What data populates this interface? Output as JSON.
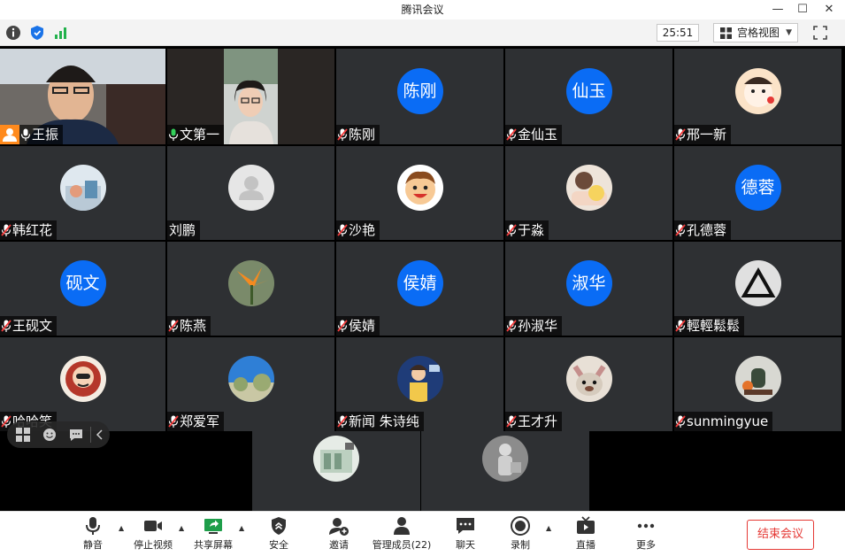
{
  "window": {
    "title": "腾讯会议",
    "minimize": "—",
    "maximize": "☐",
    "close": "✕"
  },
  "topbar": {
    "timer": "25:51",
    "view_mode": "宫格视图"
  },
  "colors": {
    "accent": "#0a6cf5",
    "active_speaker": "#20c05a",
    "host_badge": "#ff8a1d",
    "end_meeting": "#e53935"
  },
  "participants": [
    {
      "name": "王振",
      "avatar": "video",
      "mic": "on",
      "host": true
    },
    {
      "name": "文第一",
      "avatar": "video",
      "mic": "on",
      "active": true
    },
    {
      "name": "陈刚",
      "avatar": "text",
      "avatar_text": "陈刚",
      "mic": "muted"
    },
    {
      "name": "金仙玉",
      "avatar": "text",
      "avatar_text": "仙玉",
      "mic": "muted"
    },
    {
      "name": "邢一新",
      "avatar": "image-cartoon-girl",
      "mic": "muted"
    },
    {
      "name": "韩红花",
      "avatar": "image-photo",
      "mic": "muted"
    },
    {
      "name": "刘鹏",
      "avatar": "default-user",
      "mic": "none"
    },
    {
      "name": "沙艳",
      "avatar": "image-cartoon-boy",
      "mic": "muted"
    },
    {
      "name": "于淼",
      "avatar": "image-sleeping-child",
      "mic": "muted"
    },
    {
      "name": "孔德蓉",
      "avatar": "text",
      "avatar_text": "德蓉",
      "mic": "muted"
    },
    {
      "name": "王砚文",
      "avatar": "text",
      "avatar_text": "砚文",
      "mic": "muted"
    },
    {
      "name": "陈燕",
      "avatar": "image-flower",
      "mic": "muted"
    },
    {
      "name": "侯婧",
      "avatar": "text",
      "avatar_text": "侯婧",
      "mic": "muted"
    },
    {
      "name": "孙淑华",
      "avatar": "text",
      "avatar_text": "淑华",
      "mic": "muted"
    },
    {
      "name": "輕輕鬆鬆",
      "avatar": "image-triangle-logo",
      "mic": "muted"
    },
    {
      "name": "哈哈笑",
      "avatar": "image-cartoon-face",
      "mic": "muted"
    },
    {
      "name": "郑爱军",
      "avatar": "image-sky-tree",
      "mic": "muted"
    },
    {
      "name": "新闻 朱诗纯",
      "avatar": "image-cartoon-host",
      "mic": "muted"
    },
    {
      "name": "王才升",
      "avatar": "image-dog",
      "mic": "muted"
    },
    {
      "name": "sunmingyue",
      "avatar": "image-toy",
      "mic": "muted"
    },
    {
      "name": "",
      "avatar": "image-photo-wall",
      "mic": "muted"
    },
    {
      "name": "",
      "avatar": "image-photo-figure",
      "mic": "muted"
    }
  ],
  "controls": {
    "mute": "静音",
    "stop_video": "停止视频",
    "share_screen": "共享屏幕",
    "security": "安全",
    "invite": "邀请",
    "manage_members": "管理成员(22)",
    "chat": "聊天",
    "record": "录制",
    "live": "直播",
    "more": "更多",
    "end_meeting": "结束会议"
  }
}
